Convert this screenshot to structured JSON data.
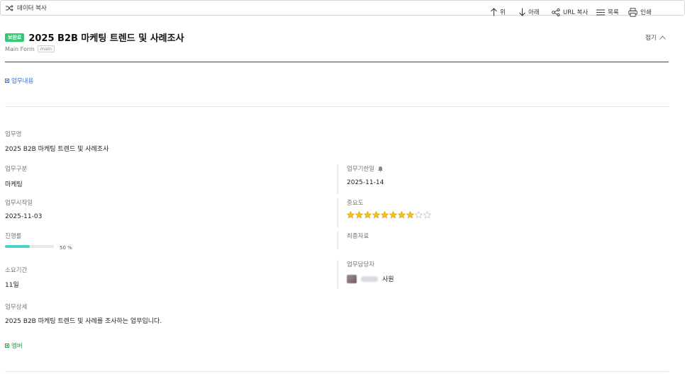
{
  "toolbar": {
    "copy_label": "데이터 복사",
    "up_label": "위",
    "down_label": "아래",
    "url_copy_label": "URL 복사",
    "list_label": "목록",
    "print_label": "인쇄"
  },
  "header": {
    "status_badge": "보완료",
    "title": "2025 B2B 마케팅 트렌드 및 사례조사",
    "form_name": "Main Form",
    "form_tag": "main",
    "collapse_label": "접기"
  },
  "sections": {
    "content_label": "업무내용",
    "member_label": "멤버"
  },
  "fields": {
    "task_name_label": "업무명",
    "task_name_value": "2025 B2B 마케팅 트렌드 및 사례조사",
    "category_label": "업무구분",
    "category_value": "마케팅",
    "due_label": "업무기한일",
    "due_value": "2025-11-14",
    "start_label": "업무시작일",
    "start_value": "2025-11-03",
    "importance_label": "중요도",
    "importance_rating": 8,
    "importance_max": 10,
    "progress_label": "진행률",
    "progress_value": "50 %",
    "progress_fraction": 0.5,
    "final_label": "최종자료",
    "duration_label": "소요기간",
    "duration_value": "11일",
    "owner_label": "업무담당자",
    "owner_role": "사원",
    "detail_label": "업무상세",
    "detail_value": "2025 B2B 마케팅 트렌드 및 사례를 조사하는 업무입니다."
  },
  "colors": {
    "status": "#2ecc71",
    "progress": "#4dd0c8",
    "link_blue": "#3b6fd6",
    "link_green": "#20a04a",
    "star": "#f5c518"
  }
}
